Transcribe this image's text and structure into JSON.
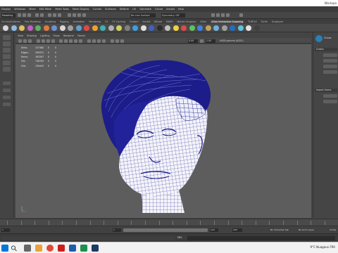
{
  "window": {
    "title": "",
    "workspace": "Workspa"
  },
  "menubar": {
    "items": [
      "Display",
      "Windows",
      "Mesh",
      "Edit Mesh",
      "Mesh Tools",
      "Mesh Display",
      "Curves",
      "Surfaces",
      "Deform",
      "UV",
      "Generate",
      "Cache",
      "Arnold",
      "Help"
    ]
  },
  "statusline": {
    "mode": "Modeling",
    "surface_field": "No Live Surface",
    "symmetry_field": "Symmetry: Off"
  },
  "shelf": {
    "tabs": [
      "Curves/Surfaces",
      "Poly Modeling",
      "Sculpting",
      "Rigging",
      "Animation",
      "Rendering",
      "FX",
      "FX Caching",
      "Custom",
      "Arnold",
      "Bifrost",
      "MASH",
      "Motion Graphics",
      "XGen",
      "XGen Interactive Grooming",
      "TURTLE",
      "Turtle",
      "Graphyne"
    ],
    "active_tab": "XGen Interactive Grooming"
  },
  "panel": {
    "menus": [
      "View",
      "Shading",
      "Lighting",
      "Show",
      "Renderer",
      "Panels"
    ],
    "near_value": "0.00",
    "far_value": "1.00",
    "camera_label": "sRGB gamma (ACES)"
  },
  "hud": {
    "rows": [
      {
        "label": "Verts:",
        "value": "137380",
        "a": "0",
        "b": "0"
      },
      {
        "label": "Edges:",
        "value": "290972",
        "a": "0",
        "b": "0"
      },
      {
        "label": "Faces:",
        "value": "163267",
        "a": "0",
        "b": "0"
      },
      {
        "label": "Tris:",
        "value": "738700",
        "a": "0",
        "b": "0"
      },
      {
        "label": "UVs:",
        "value": "139443",
        "a": "0",
        "b": "0"
      }
    ]
  },
  "right_panel": {
    "header": "Chaos",
    "section_create": "Create",
    "buttons_create": [
      "",
      "",
      "",
      ""
    ],
    "section_import": "Import Scene",
    "buttons_import": [
      "",
      ""
    ]
  },
  "timeslider": {
    "labels": [
      "",
      "",
      "",
      "",
      "",
      "",
      "",
      "",
      "",
      "",
      "",
      "",
      "",
      "",
      "",
      "",
      "",
      "",
      "",
      ""
    ]
  },
  "rangeslider": {
    "start": "1",
    "inner_start": "1",
    "inner_end": "120",
    "end": "120",
    "end2": "200",
    "character_set": "No Character Set",
    "anim_layer": "No Anim Layer",
    "fps": "24 fps"
  },
  "cmdline": {
    "language": "MEL"
  },
  "taskbar": {
    "temperature": "9°C",
    "weather": "Nuageux",
    "lang": "FRA"
  },
  "colors": {
    "wire": "#1c1c8a",
    "viewport_bg": "#5d5d5d",
    "mesh_fill": "#ffffff"
  }
}
